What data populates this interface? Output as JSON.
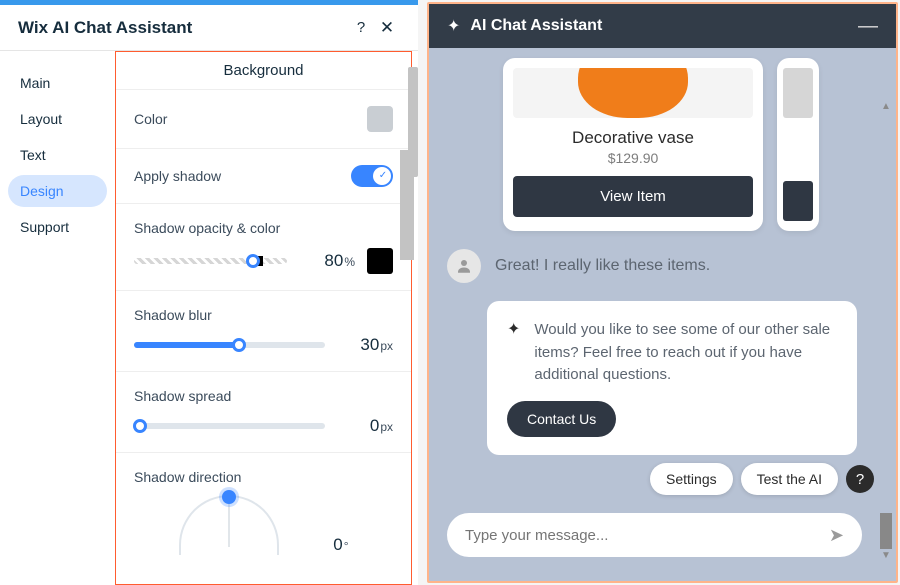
{
  "panel": {
    "title": "Wix AI Chat Assistant",
    "sidebar": [
      "Main",
      "Layout",
      "Text",
      "Design",
      "Support"
    ],
    "active_index": 3
  },
  "design": {
    "section_title": "Background",
    "rows": {
      "color_label": "Color",
      "apply_shadow_label": "Apply shadow",
      "shadow_opacity_label": "Shadow opacity & color",
      "shadow_opacity_value": "80",
      "shadow_opacity_unit": "%",
      "shadow_opacity_swatch": "#000000",
      "shadow_blur_label": "Shadow blur",
      "shadow_blur_value": "30",
      "shadow_blur_unit": "px",
      "shadow_spread_label": "Shadow spread",
      "shadow_spread_value": "0",
      "shadow_spread_unit": "px",
      "shadow_direction_label": "Shadow direction",
      "shadow_direction_value": "0",
      "shadow_direction_unit": "°"
    },
    "color_swatch": "#c9ced3",
    "apply_shadow_on": true
  },
  "chat": {
    "title": "AI Chat Assistant",
    "product": {
      "name": "Decorative vase",
      "price": "$129.90",
      "view_label": "View Item"
    },
    "user_msg": "Great! I really like these items.",
    "ai_msg": "Would you like to see some of our other sale items? Feel free to reach out if you have additional questions.",
    "contact_label": "Contact Us",
    "actions": {
      "settings": "Settings",
      "test": "Test the AI"
    },
    "input_placeholder": "Type your message..."
  }
}
